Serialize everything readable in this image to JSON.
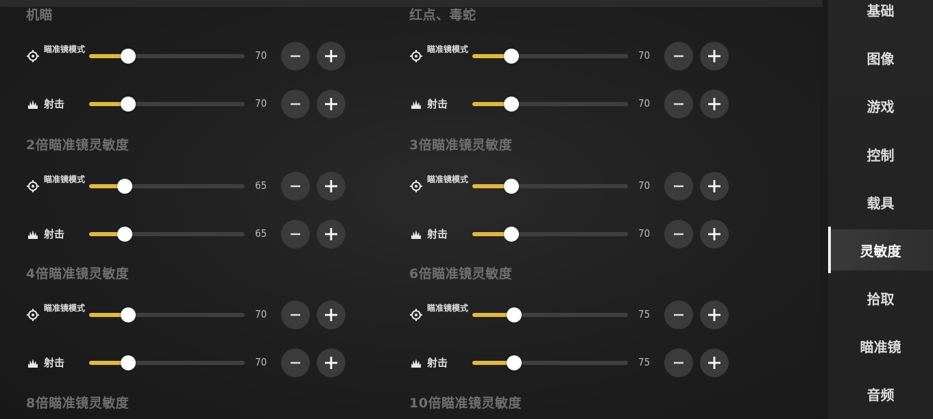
{
  "sections": [
    {
      "id": "s0",
      "title": "机瞄",
      "rows": [
        {
          "label": "瞄准镜模式",
          "value": 70,
          "fraction": 0.25
        },
        {
          "label": "射击",
          "value": 70,
          "fraction": 0.25
        }
      ]
    },
    {
      "id": "s1",
      "title": "红点、毒蛇",
      "rows": [
        {
          "label": "瞄准镜模式",
          "value": 70,
          "fraction": 0.25
        },
        {
          "label": "射击",
          "value": 70,
          "fraction": 0.25
        }
      ]
    },
    {
      "id": "s2",
      "title": "2倍瞄准镜灵敏度",
      "rows": [
        {
          "label": "瞄准镜模式",
          "value": 65,
          "fraction": 0.23
        },
        {
          "label": "射击",
          "value": 65,
          "fraction": 0.23
        }
      ]
    },
    {
      "id": "s3",
      "title": "3倍瞄准镜灵敏度",
      "rows": [
        {
          "label": "瞄准镜模式",
          "value": 70,
          "fraction": 0.25
        },
        {
          "label": "射击",
          "value": 70,
          "fraction": 0.25
        }
      ]
    },
    {
      "id": "s4",
      "title": "4倍瞄准镜灵敏度",
      "rows": [
        {
          "label": "瞄准镜模式",
          "value": 70,
          "fraction": 0.25
        },
        {
          "label": "射击",
          "value": 70,
          "fraction": 0.25
        }
      ]
    },
    {
      "id": "s5",
      "title": "6倍瞄准镜灵敏度",
      "rows": [
        {
          "label": "瞄准镜模式",
          "value": 75,
          "fraction": 0.27
        },
        {
          "label": "射击",
          "value": 75,
          "fraction": 0.27
        }
      ]
    },
    {
      "id": "s6",
      "title": "8倍瞄准镜灵敏度",
      "rows": []
    },
    {
      "id": "s7",
      "title": "10倍瞄准镜灵敏度",
      "rows": []
    }
  ],
  "sidebar": {
    "items": [
      {
        "label": "基础",
        "active": false
      },
      {
        "label": "图像",
        "active": false
      },
      {
        "label": "游戏",
        "active": false
      },
      {
        "label": "控制",
        "active": false
      },
      {
        "label": "载具",
        "active": false
      },
      {
        "label": "灵敏度",
        "active": true
      },
      {
        "label": "拾取",
        "active": false
      },
      {
        "label": "瞄准镜",
        "active": false
      },
      {
        "label": "音频",
        "active": false
      }
    ]
  },
  "icons": {
    "scope_mode": "crosshair-icon",
    "fire": "fire-spike-icon",
    "decrease": "minus-icon",
    "increase": "plus-icon"
  },
  "colors": {
    "accent": "#e3b93a",
    "knob": "#ffffff",
    "track": "#3f3f3f",
    "button_bg": "#3b3b3b"
  }
}
